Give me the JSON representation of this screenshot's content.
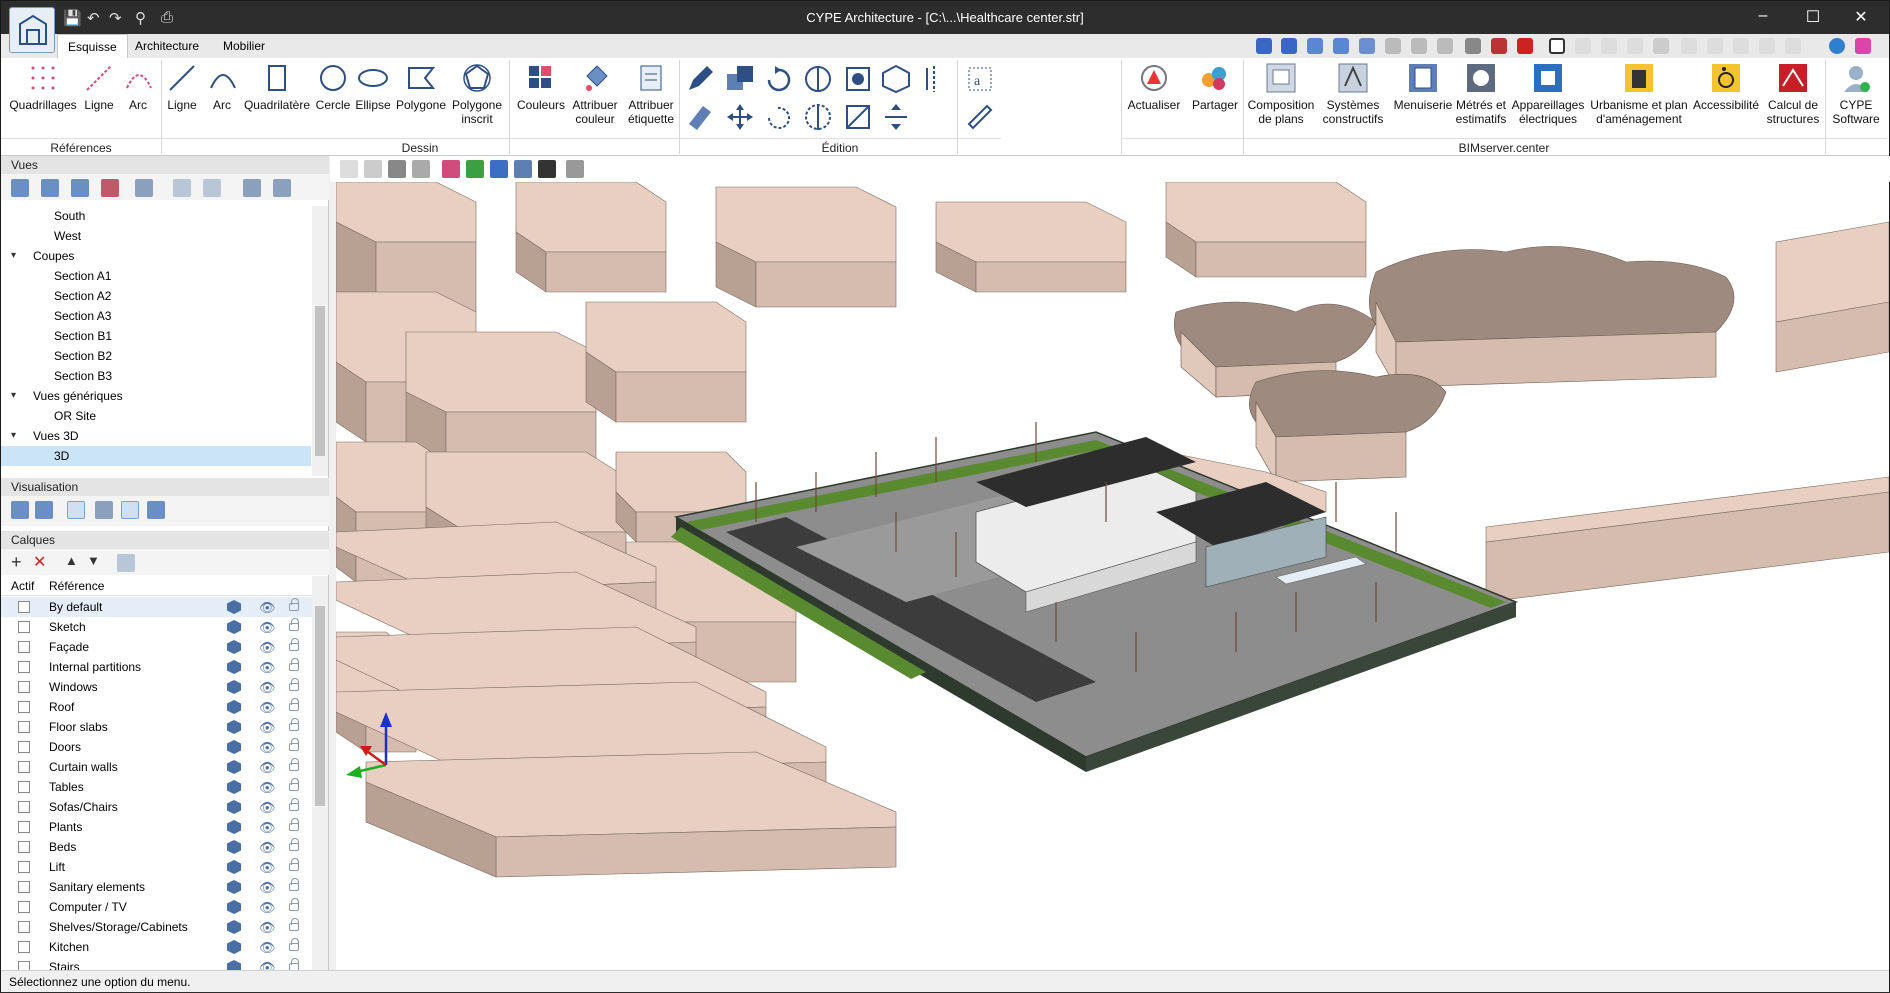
{
  "window": {
    "title": "CYPE Architecture - [C:\\...\\Healthcare center.str]",
    "controls": {
      "minimize": "–",
      "maximize": "☐",
      "close": "✕"
    }
  },
  "tabs": [
    "Esquisse",
    "Architecture",
    "Mobilier"
  ],
  "ribbon": {
    "groups": {
      "references": "Références",
      "dessin": "Dessin",
      "edition": "Édition",
      "bimserver": "BIMserver.center"
    },
    "references_buttons": [
      "Quadrillages",
      "Ligne",
      "Arc"
    ],
    "dessin_buttons": [
      "Ligne",
      "Arc",
      "Quadrilatère",
      "Cercle",
      "Ellipse",
      "Polygone",
      "Polygone inscrit",
      "Couleurs",
      "Attribuer couleur",
      "Attribuer étiquette"
    ],
    "bim_buttons": [
      "Actualiser",
      "Partager",
      "Composition de plans",
      "Systèmes constructifs",
      "Menuiserie",
      "Métrés et estimatifs",
      "Appareillages électriques",
      "Urbanisme et plan d'aménagement",
      "Accessibilité",
      "Calcul de structures",
      "CYPE Software"
    ]
  },
  "panels": {
    "vues": {
      "title": "Vues",
      "items": [
        {
          "label": "South",
          "level": 2
        },
        {
          "label": "West",
          "level": 2
        },
        {
          "label": "Coupes",
          "level": 1,
          "expanded": true
        },
        {
          "label": "Section A1",
          "level": 2
        },
        {
          "label": "Section A2",
          "level": 2
        },
        {
          "label": "Section A3",
          "level": 2
        },
        {
          "label": "Section B1",
          "level": 2
        },
        {
          "label": "Section B2",
          "level": 2
        },
        {
          "label": "Section B3",
          "level": 2
        },
        {
          "label": "Vues génériques",
          "level": 1,
          "expanded": true
        },
        {
          "label": "OR Site",
          "level": 2
        },
        {
          "label": "Vues 3D",
          "level": 1,
          "expanded": true
        },
        {
          "label": "3D",
          "level": 2,
          "selected": true
        }
      ]
    },
    "visualisation": {
      "title": "Visualisation"
    },
    "calques": {
      "title": "Calques",
      "columns": {
        "actif": "Actif",
        "reference": "Référence"
      },
      "rows": [
        "By default",
        "Sketch",
        "Façade",
        "Internal partitions",
        "Windows",
        "Roof",
        "Floor slabs",
        "Doors",
        "Curtain walls",
        "Tables",
        "Sofas/Chairs",
        "Plants",
        "Beds",
        "Lift",
        "Sanitary elements",
        "Computer / TV",
        "Shelves/Storage/Cabinets",
        "Kitchen",
        "Stairs"
      ]
    }
  },
  "status": "Sélectionnez une option du menu.",
  "colors": {
    "titlebar": "#2d2d2d",
    "building_top": "#e8cfc1",
    "building_side": "#b8a093",
    "building_dark": "#9e8a7f",
    "grass": "#5a8a2f",
    "fence": "#2f3a2f",
    "road": "#3c3c3c"
  }
}
